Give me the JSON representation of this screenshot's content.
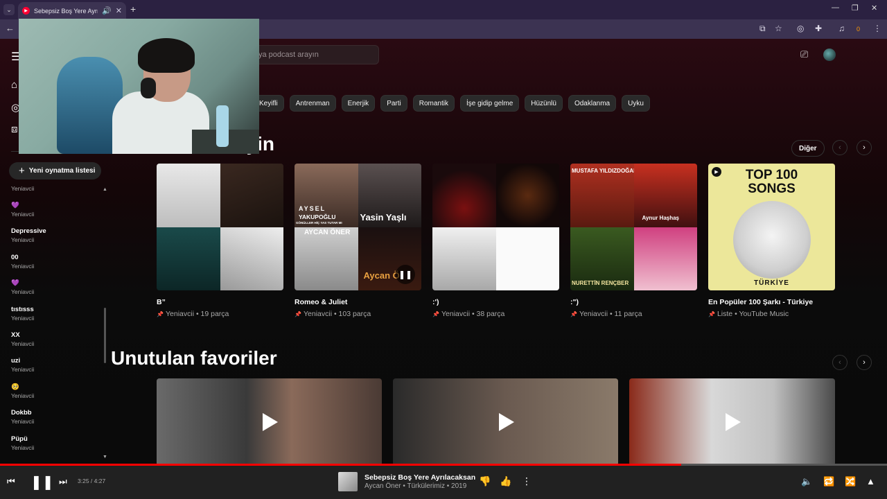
{
  "browser": {
    "tab_title": "Sebepsiz Boş Yere Ayrılacaksan",
    "tab_close": "✕",
    "new_tab": "+",
    "ext_badge": "0"
  },
  "header": {
    "search_placeholder": "ya podcast arayın"
  },
  "chips": [
    "Keyifli",
    "Antrenman",
    "Enerjik",
    "Parti",
    "Romantik",
    "İşe gidip gelme",
    "Hüzünlü",
    "Odaklanma",
    "Uyku"
  ],
  "sidebar": {
    "new_playlist_label": "Yeni oynatma listesi",
    "playlists": [
      {
        "name": "",
        "owner": "Yeniavcii"
      },
      {
        "name": "💜",
        "owner": "Yeniavcii"
      },
      {
        "name": "Depressive",
        "owner": "Yeniavcii"
      },
      {
        "name": "00",
        "owner": "Yeniavcii"
      },
      {
        "name": "💜",
        "owner": "Yeniavcii"
      },
      {
        "name": "tıstısss",
        "owner": "Yeniavcii"
      },
      {
        "name": "XX",
        "owner": "Yeniavcii"
      },
      {
        "name": "uzi",
        "owner": "Yeniavcii"
      },
      {
        "name": "🥺",
        "owner": "Yeniavcii"
      },
      {
        "name": "Dokbb",
        "owner": "Yeniavcii"
      },
      {
        "name": "Püpü",
        "owner": "Yeniavcii"
      }
    ]
  },
  "section1": {
    "title_visible": "eyin",
    "more_label": "Diğer",
    "cards": [
      {
        "title": "B”",
        "subtitle": "Yeniavcii • 19 parça"
      },
      {
        "title": "Romeo & Juliet",
        "subtitle": "Yeniavcii • 103 parça",
        "overlay_texts": [
          "AYSEL",
          "YAKUPOĞLU",
          "GÖNÜLLER HİÇ YAS TUTAR MI",
          "Yasin Yaşlı",
          "AYCAN ÖNER",
          "Aycan Ö"
        ]
      },
      {
        "title": ":')",
        "subtitle": "Yeniavcii • 38 parça"
      },
      {
        "title": ":\")",
        "subtitle": "Yeniavcii • 11 parça",
        "overlay_texts": [
          "MUSTAFA YILDIZDOĞAN",
          "Aynur Haşhaş",
          "NURETTİN RENÇBER"
        ]
      },
      {
        "title": "En Popüler 100 Şarkı - Türkiye",
        "subtitle": "Liste • YouTube Music",
        "cover_lines": [
          "TOP 100",
          "SONGS",
          "TÜRKİYE"
        ]
      }
    ]
  },
  "section2": {
    "title": "Unutulan favoriler"
  },
  "player": {
    "time": "3:25 / 4:27",
    "progress": 0.768,
    "title": "Sebepsiz Boş Yere Ayrılacaksan",
    "subtitle": "Aycan Öner • Türkülerimiz • 2019"
  },
  "colors": {
    "accent": "#ff0000",
    "chip_bg": "#2a2a2a",
    "top100_bg": "#ece79a"
  }
}
